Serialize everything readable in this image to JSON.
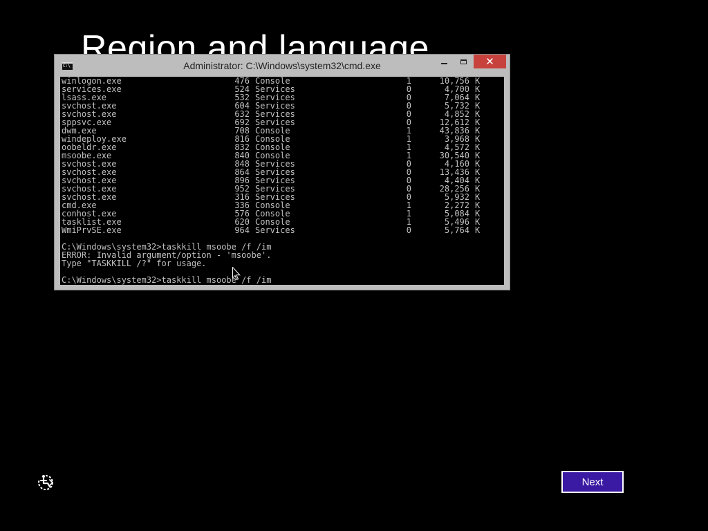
{
  "page": {
    "title": "Region and language",
    "next_label": "Next"
  },
  "cmd_window": {
    "title": "Administrator: C:\\Windows\\system32\\cmd.exe",
    "icon_text": "C:\\",
    "close_glyph": "✕",
    "processes": [
      {
        "name": "winlogon.exe",
        "pid": "476",
        "session": "Console",
        "num": "1",
        "mem": "10,756",
        "unit": "K"
      },
      {
        "name": "services.exe",
        "pid": "524",
        "session": "Services",
        "num": "0",
        "mem": "4,700",
        "unit": "K"
      },
      {
        "name": "lsass.exe",
        "pid": "532",
        "session": "Services",
        "num": "0",
        "mem": "7,064",
        "unit": "K"
      },
      {
        "name": "svchost.exe",
        "pid": "604",
        "session": "Services",
        "num": "0",
        "mem": "5,732",
        "unit": "K"
      },
      {
        "name": "svchost.exe",
        "pid": "632",
        "session": "Services",
        "num": "0",
        "mem": "4,852",
        "unit": "K"
      },
      {
        "name": "sppsvc.exe",
        "pid": "692",
        "session": "Services",
        "num": "0",
        "mem": "12,612",
        "unit": "K"
      },
      {
        "name": "dwm.exe",
        "pid": "708",
        "session": "Console",
        "num": "1",
        "mem": "43,836",
        "unit": "K"
      },
      {
        "name": "windeploy.exe",
        "pid": "816",
        "session": "Console",
        "num": "1",
        "mem": "3,968",
        "unit": "K"
      },
      {
        "name": "oobeldr.exe",
        "pid": "832",
        "session": "Console",
        "num": "1",
        "mem": "4,572",
        "unit": "K"
      },
      {
        "name": "msoobe.exe",
        "pid": "840",
        "session": "Console",
        "num": "1",
        "mem": "30,540",
        "unit": "K"
      },
      {
        "name": "svchost.exe",
        "pid": "848",
        "session": "Services",
        "num": "0",
        "mem": "4,160",
        "unit": "K"
      },
      {
        "name": "svchost.exe",
        "pid": "864",
        "session": "Services",
        "num": "0",
        "mem": "13,436",
        "unit": "K"
      },
      {
        "name": "svchost.exe",
        "pid": "896",
        "session": "Services",
        "num": "0",
        "mem": "4,404",
        "unit": "K"
      },
      {
        "name": "svchost.exe",
        "pid": "952",
        "session": "Services",
        "num": "0",
        "mem": "28,256",
        "unit": "K"
      },
      {
        "name": "svchost.exe",
        "pid": "316",
        "session": "Services",
        "num": "0",
        "mem": "5,932",
        "unit": "K"
      },
      {
        "name": "cmd.exe",
        "pid": "336",
        "session": "Console",
        "num": "1",
        "mem": "2,272",
        "unit": "K"
      },
      {
        "name": "conhost.exe",
        "pid": "576",
        "session": "Console",
        "num": "1",
        "mem": "5,084",
        "unit": "K"
      },
      {
        "name": "tasklist.exe",
        "pid": "620",
        "session": "Console",
        "num": "1",
        "mem": "5,496",
        "unit": "K"
      },
      {
        "name": "WmiPrvSE.exe",
        "pid": "964",
        "session": "Services",
        "num": "0",
        "mem": "5,764",
        "unit": "K"
      }
    ],
    "output_lines": {
      "command_1": "C:\\Windows\\system32>taskkill msoobe /f /im",
      "error": "ERROR: Invalid argument/option - 'msoobe'.",
      "usage": "Type \"TASKKILL /?\" for usage.",
      "command_2": "C:\\Windows\\system32>taskkill msoobe /f /im"
    }
  },
  "colors": {
    "background": "#000000",
    "accent": "#3a1aa3",
    "console_text": "#c0c0c0",
    "window_frame": "#bdbdbd",
    "close_button": "#c7423c"
  },
  "icons": {
    "accessibility": "ease-of-access-icon",
    "cmd": "cmd-icon",
    "cursor": "mouse-cursor-icon"
  }
}
